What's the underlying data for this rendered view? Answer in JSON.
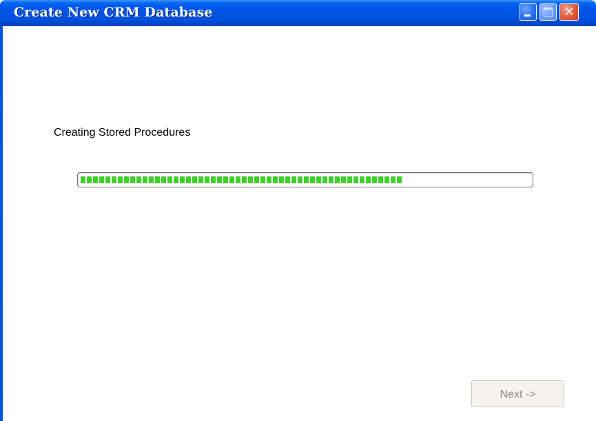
{
  "window": {
    "title": "Create New CRM Database",
    "controls": {
      "minimize_icon": "minimize-icon",
      "maximize_icon": "maximize-icon",
      "close_icon": "close-icon",
      "close_glyph": "✕"
    }
  },
  "main": {
    "status_text": "Creating Stored Procedures",
    "progress": {
      "fraction": 0.72,
      "color": "#3fcf2a"
    },
    "next_button": {
      "label": "Next ->",
      "enabled": false
    }
  },
  "colors": {
    "titlebar": "#0055e5",
    "progress_fill": "#3fcf2a",
    "close_button": "#e05a3a"
  }
}
